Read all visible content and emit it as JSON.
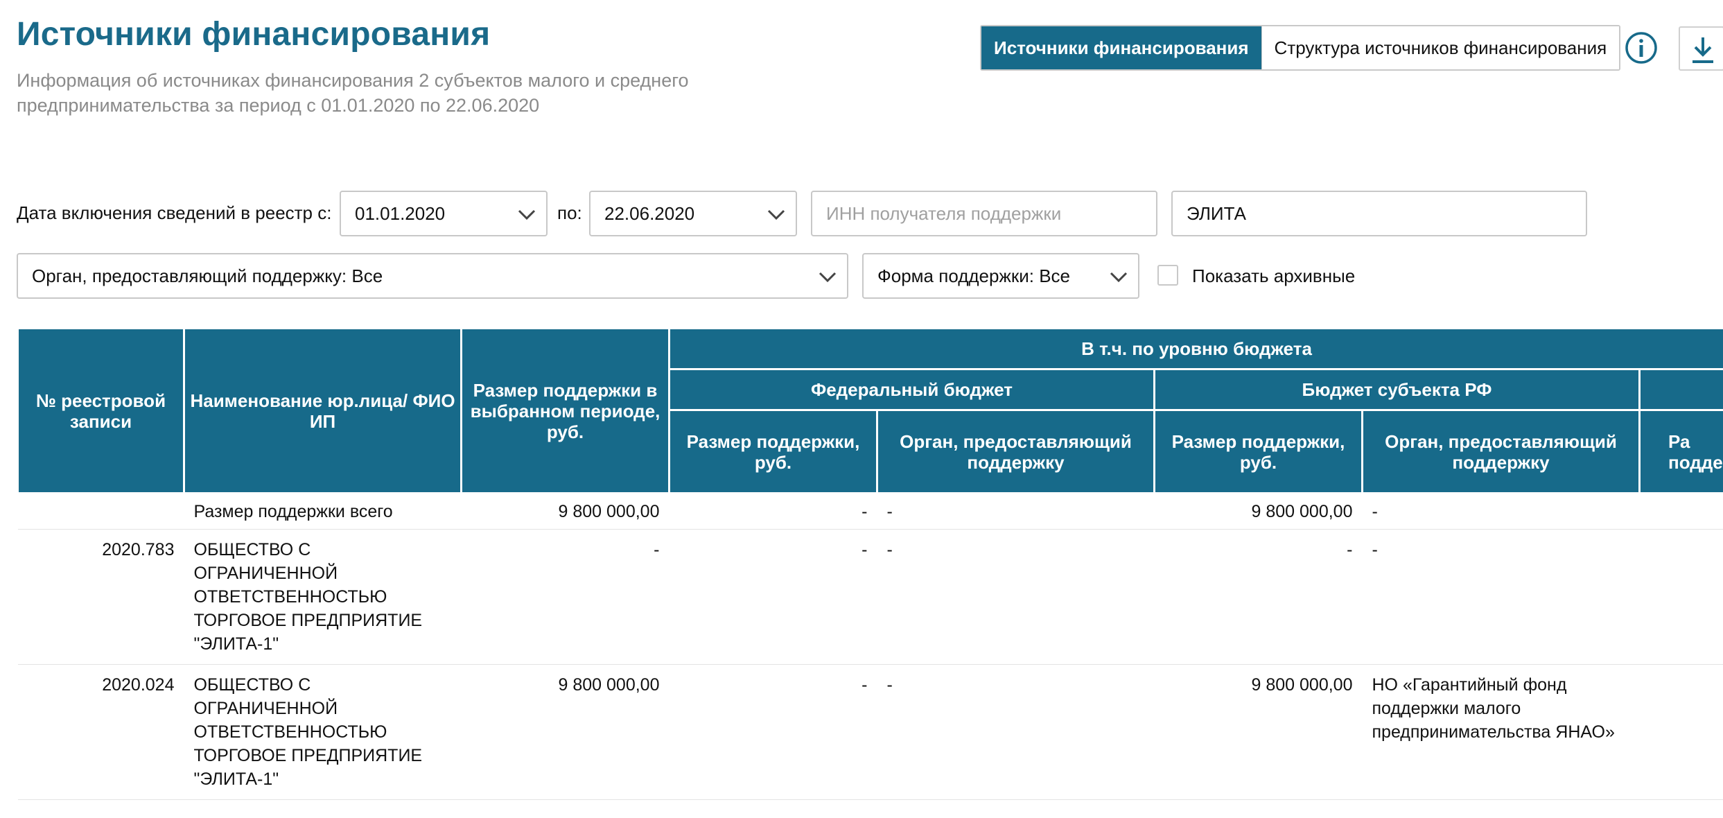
{
  "header": {
    "title": "Источники финансирования",
    "subtitle": "Информация об источниках финансирования 2 субъектов малого и среднего предпринимательства за период с 01.01.2020 по 22.06.2020"
  },
  "view_toggle": {
    "options": [
      "Источники финансирования",
      "Структура источников финансирования"
    ],
    "active": "Источники финансирования"
  },
  "icons": {
    "info": "info-icon",
    "download": "download-icon",
    "dropdown": "chevron-down-icon"
  },
  "colors": {
    "accent": "#176a8a",
    "title": "#1a6a8a",
    "muted": "#8a8a8a"
  },
  "filters": {
    "date_from_label": "Дата включения сведений в реестр с:",
    "date_from": "01.01.2020",
    "date_to_label": "по:",
    "date_to": "22.06.2020",
    "inn_placeholder": "ИНН получателя поддержки",
    "name_value": "ЭЛИТА",
    "organ_select": "Орган, предоставляющий поддержку: Все",
    "form_select": "Форма поддержки: Все",
    "archive_label": "Показать архивные"
  },
  "table": {
    "headers": {
      "registry_no": "№ реестровой записи",
      "name": "Наименование юр.лица/ ФИО ИП",
      "amount_period": "Размер поддержки в выбранном периоде, руб.",
      "by_budget": "В т.ч. по уровню бюджета",
      "federal": "Федеральный бюджет",
      "regional": "Бюджет субъекта РФ",
      "amount": "Размер поддержки, руб.",
      "organ": "Орган, предоставляющий поддержку",
      "cut_amount": "Ра подде"
    },
    "total": {
      "label": "Размер поддержки всего",
      "amount": "9 800 000,00",
      "fed_amount": "-",
      "fed_organ": "-",
      "reg_amount": "9 800 000,00",
      "reg_organ": "-"
    },
    "rows": [
      {
        "registry_no": "2020.783",
        "name": "ОБЩЕСТВО С ОГРАНИЧЕННОЙ ОТВЕТСТВЕННОСТЬЮ ТОРГОВОЕ ПРЕДПРИЯТИЕ \"ЭЛИТА-1\"",
        "amount": "-",
        "fed_amount": "-",
        "fed_organ": "-",
        "reg_amount": "-",
        "reg_organ": "-"
      },
      {
        "registry_no": "2020.024",
        "name": "ОБЩЕСТВО С ОГРАНИЧЕННОЙ ОТВЕТСТВЕННОСТЬЮ ТОРГОВОЕ ПРЕДПРИЯТИЕ \"ЭЛИТА-1\"",
        "amount": "9 800 000,00",
        "fed_amount": "-",
        "fed_organ": "-",
        "reg_amount": "9 800 000,00",
        "reg_organ": "НО «Гарантийный фонд поддержки малого предпринимательства ЯНАО»"
      }
    ]
  }
}
